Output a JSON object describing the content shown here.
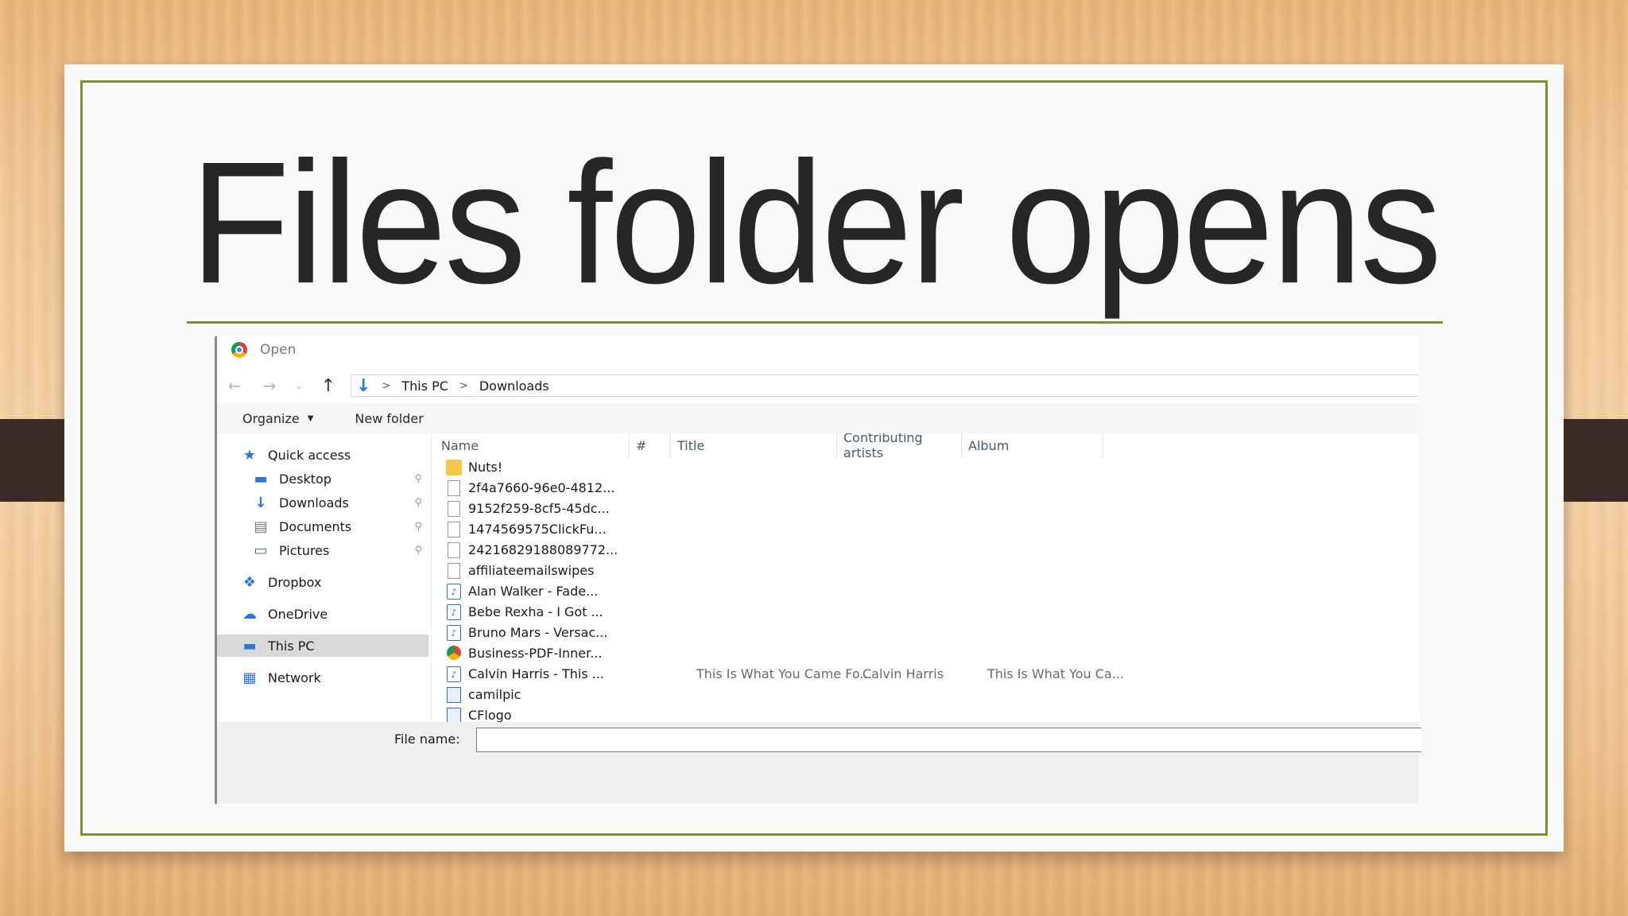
{
  "slide": {
    "title": "Files folder opens",
    "accent_color": "#78912f"
  },
  "dialog": {
    "title": "Open",
    "title_icon": "chrome-icon",
    "nav": {
      "back": "←",
      "forward": "→",
      "recent": "⌄",
      "up": "↑"
    },
    "breadcrumb": {
      "icon": "downloads-icon",
      "items": [
        "This PC",
        "Downloads"
      ],
      "separator": ">"
    },
    "toolbar": {
      "organize": "Organize",
      "new_folder": "New folder"
    },
    "navigation": [
      {
        "label": "Quick access",
        "icon": "star-icon",
        "pinned": false
      },
      {
        "label": "Desktop",
        "icon": "desktop-icon",
        "pinned": true
      },
      {
        "label": "Downloads",
        "icon": "downloads-icon",
        "pinned": true
      },
      {
        "label": "Documents",
        "icon": "documents-icon",
        "pinned": true
      },
      {
        "label": "Pictures",
        "icon": "pictures-icon",
        "pinned": true
      },
      {
        "label": "Dropbox",
        "icon": "dropbox-icon",
        "pinned": false
      },
      {
        "label": "OneDrive",
        "icon": "onedrive-icon",
        "pinned": false
      },
      {
        "label": "This PC",
        "icon": "computer-icon",
        "pinned": false,
        "selected": true
      },
      {
        "label": "Network",
        "icon": "network-icon",
        "pinned": false
      }
    ],
    "columns": [
      "Name",
      "#",
      "Title",
      "Contributing artists",
      "Album"
    ],
    "files": [
      {
        "name": "Nuts!",
        "icon": "folder-icon",
        "title": "",
        "artist": "",
        "album": ""
      },
      {
        "name": "2f4a7660-96e0-4812...",
        "icon": "document-icon",
        "title": "",
        "artist": "",
        "album": ""
      },
      {
        "name": "9152f259-8cf5-45dc...",
        "icon": "document-icon",
        "title": "",
        "artist": "",
        "album": ""
      },
      {
        "name": "1474569575ClickFu...",
        "icon": "document-icon",
        "title": "",
        "artist": "",
        "album": ""
      },
      {
        "name": "24216829188089772...",
        "icon": "document-icon",
        "title": "",
        "artist": "",
        "album": ""
      },
      {
        "name": "affiliateemailswipes",
        "icon": "document-icon",
        "title": "",
        "artist": "",
        "album": ""
      },
      {
        "name": "Alan Walker - Fade...",
        "icon": "music-file-icon",
        "title": "",
        "artist": "",
        "album": ""
      },
      {
        "name": "Bebe Rexha - I Got ...",
        "icon": "music-file-icon",
        "title": "",
        "artist": "",
        "album": ""
      },
      {
        "name": "Bruno Mars - Versac...",
        "icon": "music-file-icon",
        "title": "",
        "artist": "",
        "album": ""
      },
      {
        "name": "Business-PDF-Inner...",
        "icon": "chrome-icon",
        "title": "",
        "artist": "",
        "album": ""
      },
      {
        "name": "Calvin Harris - This ...",
        "icon": "music-file-icon",
        "title": "This Is What You Came Fo...",
        "artist": "Calvin Harris",
        "album": "This Is What You Ca..."
      },
      {
        "name": "camilpic",
        "icon": "image-file-icon",
        "title": "",
        "artist": "",
        "album": ""
      },
      {
        "name": "CFlogo",
        "icon": "image-file-icon",
        "title": "",
        "artist": "",
        "album": ""
      }
    ],
    "filename": {
      "label": "File name:",
      "value": ""
    }
  }
}
